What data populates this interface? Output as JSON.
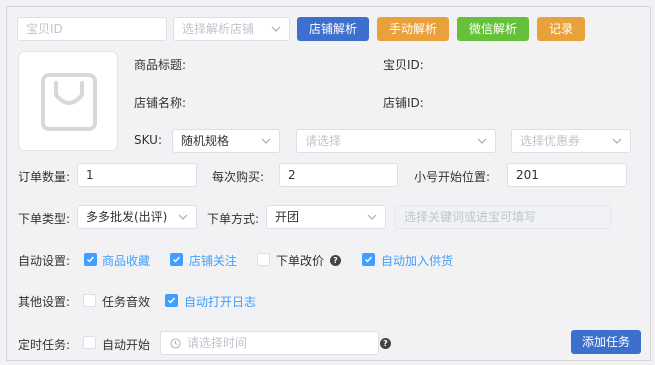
{
  "top": {
    "item_id_placeholder": "宝贝ID",
    "shop_select_placeholder": "选择解析店铺",
    "btn_shop_parse": "店铺解析",
    "btn_manual_parse": "手动解析",
    "btn_wechat_parse": "微信解析",
    "btn_record": "记录"
  },
  "colors": {
    "blue": "#3d6fce",
    "orange": "#e9a13c",
    "green": "#66c13a",
    "check_blue": "#409eff"
  },
  "product": {
    "title_label": "商品标题:",
    "item_id_label": "宝贝ID:",
    "shop_name_label": "店铺名称:",
    "shop_id_label": "店铺ID:",
    "sku_label": "SKU:",
    "sku_value": "随机规格",
    "sku_option_placeholder": "请选择",
    "coupon_placeholder": "选择优惠券",
    "image_icon": "shopping-bag-icon"
  },
  "order": {
    "qty_label": "订单数量:",
    "qty_value": "1",
    "per_buy_label": "每次购买:",
    "per_buy_value": "2",
    "start_pos_label": "小号开始位置:",
    "start_pos_value": "201"
  },
  "type": {
    "order_type_label": "下单类型:",
    "order_type_value": "多多批发(出评)",
    "method_label": "下单方式:",
    "method_value": "开团",
    "keyword_placeholder": "选择关键词或进宝可填写"
  },
  "auto": {
    "label": "自动设置:",
    "options": [
      {
        "label": "商品收藏",
        "checked": true
      },
      {
        "label": "店铺关注",
        "checked": true
      },
      {
        "label": "下单改价",
        "checked": false
      },
      {
        "label": "自动加入供货",
        "checked": true
      }
    ]
  },
  "other": {
    "label": "其他设置:",
    "options": [
      {
        "label": "任务音效",
        "checked": false
      },
      {
        "label": "自动打开日志",
        "checked": true
      }
    ]
  },
  "timer": {
    "label": "定时任务:",
    "auto_start_label": "自动开始",
    "auto_start_checked": false,
    "time_placeholder": "请选择时间",
    "add_task_button": "添加任务"
  }
}
